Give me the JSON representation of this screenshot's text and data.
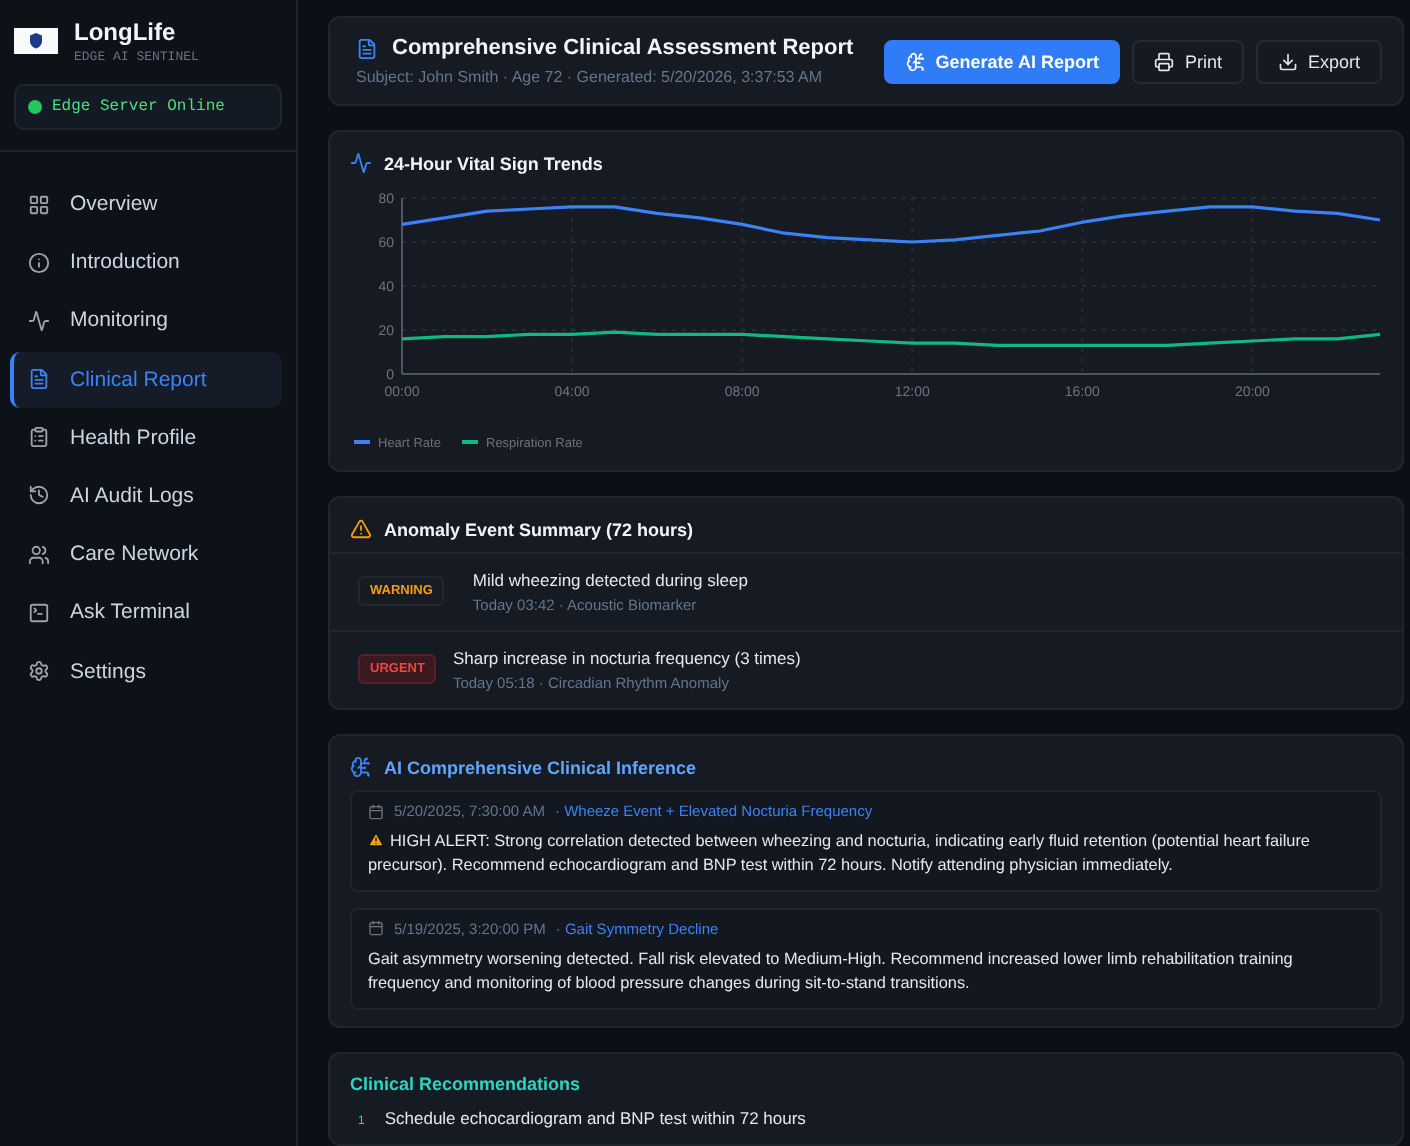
{
  "brand": {
    "name": "LongLife",
    "tagline": "EDGE AI SENTINEL",
    "server_status": "Edge Server Online"
  },
  "nav": [
    {
      "label": "Overview",
      "selected": false
    },
    {
      "label": "Introduction",
      "selected": false
    },
    {
      "label": "Monitoring",
      "selected": false
    },
    {
      "label": "Clinical Report",
      "selected": true
    },
    {
      "label": "Health Profile",
      "selected": false
    },
    {
      "label": "AI Audit Logs",
      "selected": false
    },
    {
      "label": "Care Network",
      "selected": false
    },
    {
      "label": "Ask Terminal",
      "selected": false
    },
    {
      "label": "Settings",
      "selected": false
    }
  ],
  "report": {
    "title": "Comprehensive Clinical Assessment Report",
    "subtitle": "Subject: John Smith · Age 72 · Generated: 5/20/2026, 3:37:53 AM",
    "buttons": [
      {
        "label": "Generate AI Report",
        "kind": "primary"
      },
      {
        "label": "Print",
        "kind": "secondary"
      },
      {
        "label": "Export",
        "kind": "secondary"
      }
    ]
  },
  "vitals": {
    "title": "24-Hour Vital Sign Trends",
    "chart_data": {
      "type": "line",
      "x": [
        0,
        1,
        2,
        3,
        4,
        5,
        6,
        7,
        8,
        9,
        10,
        11,
        12,
        13,
        14,
        15,
        16,
        17,
        18,
        19,
        20,
        21,
        22,
        23
      ],
      "xlim": [
        0,
        23
      ],
      "grid": true,
      "legend": true,
      "xticks": [
        {
          "value": 0,
          "label": "00:00"
        },
        {
          "value": 4,
          "label": "04:00"
        },
        {
          "value": 8,
          "label": "08:00"
        },
        {
          "value": 12,
          "label": "12:00"
        },
        {
          "value": 16,
          "label": "16:00"
        },
        {
          "value": 20,
          "label": "20:00"
        }
      ],
      "ylim": [
        0,
        80
      ],
      "yticks": [
        0,
        20,
        40,
        60,
        80
      ],
      "series": [
        {
          "name": "Heart Rate",
          "color": "#3b82f6",
          "values": [
            68,
            71,
            74,
            75,
            76,
            76,
            73,
            71,
            68,
            64,
            62,
            61,
            60,
            61,
            63,
            65,
            69,
            72,
            74,
            76,
            76,
            74,
            73,
            70
          ]
        },
        {
          "name": "Respiration Rate",
          "color": "#10b981",
          "values": [
            16,
            17,
            17,
            18,
            18,
            19,
            18,
            18,
            18,
            17,
            16,
            15,
            14,
            14,
            13,
            13,
            13,
            13,
            13,
            14,
            15,
            16,
            16,
            18
          ]
        }
      ]
    }
  },
  "anomalies": {
    "title": "Anomaly Event Summary (72 hours)",
    "events": [
      {
        "kind": "warning",
        "badge": "WARNING",
        "title": "Mild wheezing detected during sleep",
        "meta": "Today 03:42 · Acoustic Biomarker"
      },
      {
        "kind": "urgent",
        "badge": "URGENT",
        "title": "Sharp increase in nocturia frequency (3 times)",
        "meta": "Today 05:18 · Circadian Rhythm Anomaly"
      }
    ]
  },
  "inference": {
    "title": "AI Comprehensive Clinical Inference",
    "entries": [
      {
        "time": "5/20/2025, 7:30:00 AM",
        "tag": "· Wheeze Event + Elevated Nocturia Frequency",
        "kind": "alert",
        "text": "HIGH ALERT: Strong correlation detected between wheezing and nocturia, indicating early fluid retention (potential heart failure precursor). Recommend echocardiogram and BNP test within 72 hours. Notify attending physician immediately."
      },
      {
        "time": "5/19/2025, 3:20:00 PM",
        "tag": "· Gait Symmetry Decline",
        "kind": "note",
        "text": "Gait asymmetry worsening detected. Fall risk elevated to Medium-High. Recommend increased lower limb rehabilitation training frequency and monitoring of blood pressure changes during sit-to-stand transitions."
      }
    ]
  },
  "recommendations": {
    "title": "Clinical Recommendations",
    "items": [
      {
        "number": "1",
        "text": "Schedule echocardiogram and BNP test within 72 hours"
      }
    ]
  }
}
